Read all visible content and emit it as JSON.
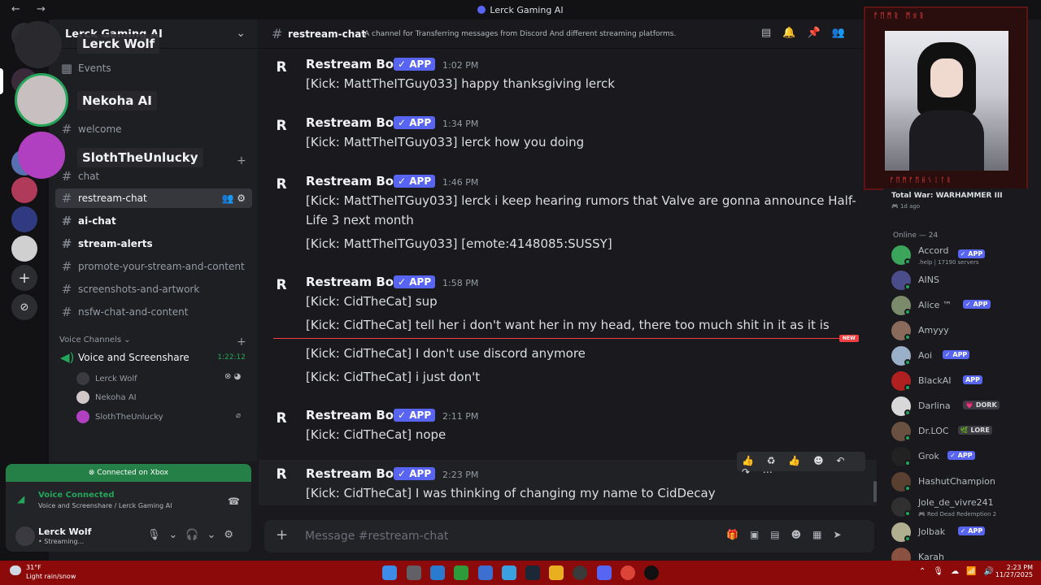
{
  "window": {
    "title": "Lerck Gaming AI",
    "nav": "← →"
  },
  "server": {
    "name": "Lerck Gaming AI",
    "events_label": "Events",
    "channels": [
      {
        "name": "welcome",
        "state": "normal"
      },
      {
        "name": "chat",
        "state": "normal"
      },
      {
        "name": "restream-chat",
        "state": "active"
      },
      {
        "name": "ai-chat",
        "state": "unread"
      },
      {
        "name": "stream-alerts",
        "state": "unread"
      },
      {
        "name": "promote-your-stream-and-content",
        "state": "normal"
      },
      {
        "name": "screenshots-and-artwork",
        "state": "normal"
      },
      {
        "name": "nsfw-chat-and-content",
        "state": "normal"
      }
    ],
    "voice_category": "Voice Channels",
    "voice_channel": {
      "name": "Voice and Screenshare",
      "timer": "1:22:12",
      "users": [
        "Lerck Wolf",
        "Nekoha AI",
        "SlothTheUnlucky"
      ]
    }
  },
  "overlay_users": [
    "Lerck Wolf",
    "Nekoha AI",
    "SlothTheUnlucky"
  ],
  "user_panel": {
    "xbox": "Connected on Xbox",
    "voice_status": "Voice Connected",
    "voice_location": "Voice and Screenshare / Lerck Gaming AI",
    "username": "Lerck Wolf",
    "status": "• Streaming..."
  },
  "chat": {
    "channel": "restream-chat",
    "topic": "A channel for Transferring messages from Discord And different streaming platforms.",
    "badge": "✓ APP",
    "new_label": "NEW",
    "composer_placeholder": "Message #restream-chat",
    "messages": [
      {
        "author": "Restream Bot",
        "time": "1:02 PM",
        "lines": [
          "[Kick: MattTheITGuy033] happy thanksgiving lerck"
        ]
      },
      {
        "author": "Restream Bot",
        "time": "1:34 PM",
        "lines": [
          "[Kick: MattTheITGuy033] lerck how you doing"
        ]
      },
      {
        "author": "Restream Bot",
        "time": "1:46 PM",
        "lines": [
          "[Kick: MattTheITGuy033] lerck i keep hearing rumors that Valve are gonna announce Half-",
          "Life 3 next month",
          "[Kick: MattTheITGuy033] [emote:4148085:SUSSY]"
        ]
      },
      {
        "author": "Restream Bot",
        "time": "1:58 PM",
        "lines": [
          "[Kick: CidTheCat] sup",
          "[Kick: CidTheCat] tell her i don't want her in my head, there too much shit in it as it is",
          "[Kick: CidTheCat] I don't use discord anymore",
          "[Kick: CidTheCat] i just don't"
        ]
      },
      {
        "author": "Restream Bot",
        "time": "2:11 PM",
        "lines": [
          "[Kick: CidTheCat] nope"
        ]
      },
      {
        "author": "Restream Bot",
        "time": "2:23 PM",
        "lines": [
          "[Kick: CidTheCat] I was thinking of changing my name to CidDecay"
        ]
      }
    ],
    "reactions": "👍 ♻ 👍 ☻ ↶ ↷ ⋯"
  },
  "members": {
    "activity_title": "Total War: WARHAMMER III",
    "activity_time": "1d ago",
    "online_header": "Online — 24",
    "list": [
      {
        "name": "Accord",
        "tag": "✓ APP",
        "sub": ".help | 17190 servers",
        "color": "#3ba55c"
      },
      {
        "name": "AINS",
        "tag": "",
        "sub": "",
        "color": "#4a4d8a"
      },
      {
        "name": "Alice ™",
        "tag": "✓ APP",
        "sub": "",
        "color": "#7a8a6a"
      },
      {
        "name": "Amyyy",
        "tag": "",
        "sub": "",
        "color": "#8a6a5a"
      },
      {
        "name": "Aoi",
        "tag": "✓ APP",
        "sub": "",
        "color": "#9ab0c8"
      },
      {
        "name": "BlackAI",
        "tag": "APP",
        "sub": "",
        "color": "#b02020"
      },
      {
        "name": "Darlina",
        "tag": "💗 DORK",
        "sub": "",
        "color": "#d8d8d8"
      },
      {
        "name": "Dr.LOC",
        "tag": "🌿 LORE",
        "sub": "",
        "color": "#6a5040"
      },
      {
        "name": "Grok",
        "tag": "✓ APP",
        "sub": "",
        "color": "#222"
      },
      {
        "name": "HashutChampion",
        "tag": "",
        "sub": "",
        "color": "#5a4030"
      },
      {
        "name": "Jole_de_vivre241",
        "tag": "",
        "sub": "🎮 Red Dead Redemption 2",
        "color": "#303030"
      },
      {
        "name": "Jolbak",
        "tag": "✓ APP",
        "sub": "",
        "color": "#b0b090"
      },
      {
        "name": "Karah",
        "tag": "",
        "sub": "",
        "color": "#8a5040"
      }
    ]
  },
  "stream_overlay": {
    "top_runes": "ᚠᛖᛗᚱ ᛗᛟᚱ",
    "bottom_runes": "ᚠᛖᛗᚠᛖᚺᛊᛁᛚᚱ"
  },
  "taskbar": {
    "temp": "31°F",
    "weather": "Light rain/snow",
    "time": "2:23 PM",
    "date": "11/27/2025"
  },
  "colors": {
    "accent": "#5865f2",
    "online": "#23a55a",
    "new_marker": "#f23f42",
    "taskbar": "#8c0a0a"
  }
}
